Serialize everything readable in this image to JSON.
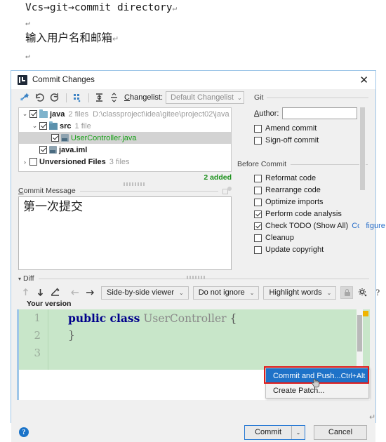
{
  "document": {
    "line1": "Vcs→git→commit directory",
    "pilcrow": "↵",
    "line2": "↵",
    "line3": "输入用户名和邮箱",
    "line4": "↵",
    "trailing_pilcrow": "↵"
  },
  "dialog": {
    "title": "Commit Changes",
    "app_icon": "intellij-idea-icon",
    "close_icon": "✕",
    "toolbar": {
      "icons": [
        "show-diff-icon",
        "revert-icon",
        "refresh-icon",
        "group-by-icon",
        "expand-all-icon",
        "collapse-all-icon"
      ],
      "changelist_label": "Changelist:",
      "changelist_label_mnemonic": "C",
      "changelist_value": "Default Changelist",
      "changelist_arrow": "⌄"
    },
    "tree": {
      "rows": [
        {
          "indent": 0,
          "twisty": "⌄",
          "checked": true,
          "icon": "folder-icon",
          "name": "java",
          "meta": "2 files",
          "path": "D:\\classproject\\idea\\gitee\\project02\\java",
          "selected": false,
          "green": false
        },
        {
          "indent": 1,
          "twisty": "⌄",
          "checked": true,
          "icon": "folder-icon",
          "name": "src",
          "meta": "1 file",
          "path": "",
          "selected": false,
          "green": false
        },
        {
          "indent": 2,
          "twisty": "",
          "checked": true,
          "icon": "java-file-icon",
          "name": "UserController.java",
          "meta": "",
          "path": "",
          "selected": true,
          "green": true
        },
        {
          "indent": 1,
          "twisty": "",
          "checked": true,
          "icon": "java-module-icon",
          "name": "java.iml",
          "meta": "",
          "path": "",
          "selected": false,
          "green": false
        },
        {
          "indent": 0,
          "twisty": "›",
          "checked": false,
          "icon": "",
          "name": "Unversioned Files",
          "meta": "3 files",
          "path": "",
          "selected": false,
          "green": false
        }
      ],
      "added_count": "2 added"
    },
    "commit_message": {
      "label": "Commit Message",
      "label_mnemonic": "C",
      "value": "第一次提交",
      "history_icon": "commit-message-history-icon"
    },
    "git_section": {
      "title": "Git",
      "author_label": "Author:",
      "author_mnemonic": "A",
      "author_value": "",
      "checkboxes": [
        {
          "label": "Amend commit",
          "checked": false
        },
        {
          "label": "Sign-off commit",
          "checked": false
        }
      ]
    },
    "before_commit_section": {
      "title": "Before Commit",
      "checkboxes": [
        {
          "label": "Reformat code",
          "checked": false,
          "link": ""
        },
        {
          "label": "Rearrange code",
          "checked": false,
          "link": ""
        },
        {
          "label": "Optimize imports",
          "checked": false,
          "link": ""
        },
        {
          "label": "Perform code analysis",
          "checked": true,
          "link": ""
        },
        {
          "label": "Check TODO (Show All)",
          "checked": true,
          "link": "Configure"
        },
        {
          "label": "Cleanup",
          "checked": false,
          "link": ""
        },
        {
          "label": "Update copyright",
          "checked": false,
          "link": ""
        }
      ]
    },
    "diff": {
      "title": "Diff",
      "caret": "▾",
      "icons": [
        "previous-difference-icon",
        "next-difference-icon",
        "edit-source-icon",
        "accept-left-icon",
        "accept-right-icon"
      ],
      "viewer_mode": "Side-by-side viewer",
      "ignore_mode": "Do not ignore",
      "highlight_mode": "Highlight words",
      "arrow": "⌄",
      "lock_icon": "lock-icon",
      "settings_icon": "gear-icon",
      "help_icon": "?",
      "your_version_label": "Your version"
    },
    "editor": {
      "line_numbers": [
        "1",
        "2",
        "3"
      ],
      "lines": [
        {
          "keyword": "public class",
          "name": " UserController",
          "brace": " {"
        },
        {
          "keyword": "",
          "name": "",
          "brace": "}"
        },
        {
          "keyword": "",
          "name": "",
          "brace": ""
        }
      ],
      "marker_color": "#f0b400",
      "added_background": "#c8e6c9"
    },
    "context_menu": {
      "items": [
        {
          "label": "Commit and Push...",
          "shortcut": "Ctrl+Alt",
          "active": true
        },
        {
          "label": "Create Patch...",
          "shortcut": "",
          "active": false
        }
      ],
      "highlight_color": "#e01b1b",
      "active_color": "#1e72c8",
      "cursor_icon": "hand-cursor-icon"
    },
    "bottom_bar": {
      "help_icon": "?",
      "commit_label": "Commit",
      "commit_arrow": "⌄",
      "cancel_label": "Cancel"
    }
  }
}
